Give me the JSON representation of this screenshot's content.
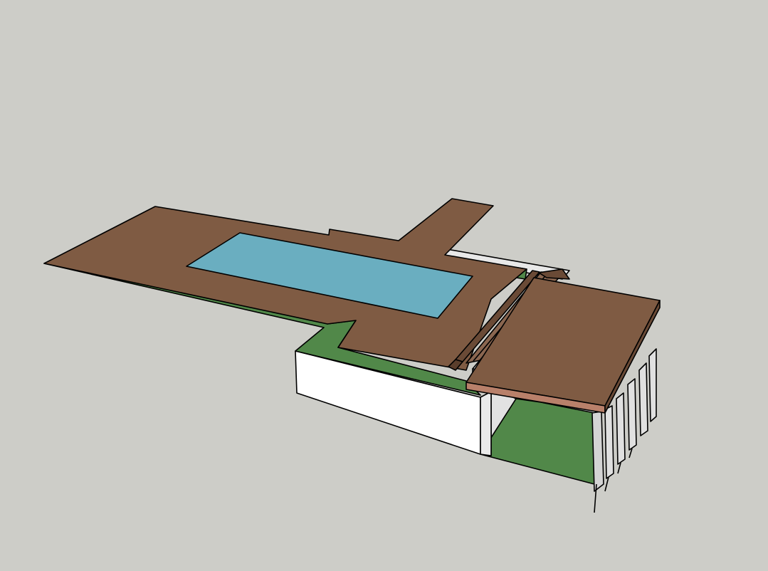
{
  "scene": {
    "background": "#cdcdc8",
    "materials": {
      "deck": "#7f5b43",
      "pool_water": "#6aaec0",
      "grass": "#518849",
      "wall": "#ffffff",
      "wall_shadow": "#e2e2e2",
      "roof_fascia": "#b8806a",
      "steel_frame": "#d4d4d4",
      "edge_lines": "#000000"
    },
    "objects": [
      "deck",
      "pool",
      "grass-strip",
      "retaining-wall",
      "pergola-roof",
      "support-columns",
      "bench"
    ]
  }
}
